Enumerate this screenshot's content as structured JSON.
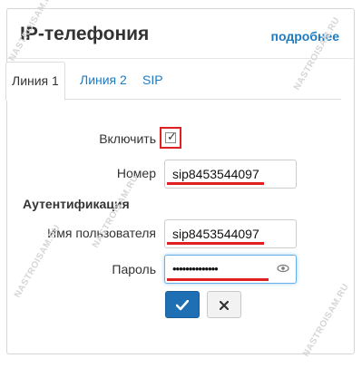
{
  "header": {
    "title": "IP-телефония",
    "more_link": "подробнее"
  },
  "tabs": [
    {
      "label": "Линия 1",
      "active": true
    },
    {
      "label": "Линия 2",
      "active": false
    },
    {
      "label": "SIP",
      "active": false
    }
  ],
  "form": {
    "enable_label": "Включить",
    "enable_checked": true,
    "number_label": "Номер",
    "number_value": "sip8453544097",
    "auth_section": "Аутентификация",
    "username_label": "Имя пользователя",
    "username_value": "sip8453544097",
    "password_label": "Пароль",
    "password_masked": "••••••••••••••"
  },
  "buttons": {
    "save_icon": "checkmark-icon",
    "cancel_icon": "close-icon"
  },
  "watermarks": {
    "text": "NASTROISAM.RU"
  },
  "colors": {
    "link": "#1e7bc0",
    "primary_button": "#1f6fb5",
    "highlight": "#e02020"
  }
}
